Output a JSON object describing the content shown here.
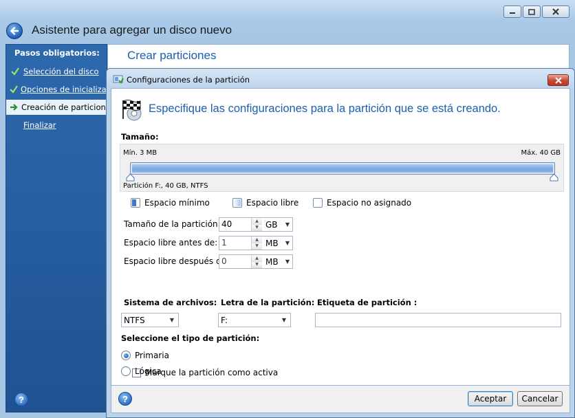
{
  "wizard": {
    "title": "Asistente para agregar un disco nuevo",
    "content_title": "Crear particiones",
    "sidebar": {
      "heading": "Pasos obligatorios:",
      "steps": [
        {
          "label": "Selección del disco",
          "state": "done"
        },
        {
          "label": "Opciones de inicialización",
          "state": "done"
        },
        {
          "label": "Creación de particiones",
          "state": "current"
        },
        {
          "label": "Finalizar",
          "state": "pending"
        }
      ]
    }
  },
  "dialog": {
    "title": "Configuraciones de la partición",
    "heading": "Especifique las configuraciones para la partición que se está creando.",
    "size": {
      "label": "Tamaño:",
      "min_label": "Mín. 3 MB",
      "max_label": "Máx. 40 GB",
      "partition_label": "Partición F:, 40 GB, NTFS",
      "fill_fraction": 1.0
    },
    "legend": {
      "min_space": "Espacio mínimo",
      "free_space": "Espacio libre",
      "unallocated": "Espacio no asignado"
    },
    "fields": {
      "partition_size": {
        "label": "Tamaño de la partición:",
        "value": "40",
        "unit": "GB"
      },
      "free_before": {
        "label": "Espacio libre antes de:",
        "value": "1",
        "unit": "MB"
      },
      "free_after": {
        "label": "Espacio libre después de:",
        "value": "0",
        "unit": "MB"
      }
    },
    "filesystem": {
      "label": "Sistema de archivos:",
      "value": "NTFS"
    },
    "letter": {
      "label": "Letra de la partición:",
      "value": "F:"
    },
    "volume_label": {
      "label": "Etiqueta de partición :",
      "value": ""
    },
    "partition_type": {
      "label": "Seleccione el tipo de partición:",
      "primary": "Primaria",
      "active_checkbox": "Marque la partición como activa",
      "logical": "Lógica",
      "selected": "primary",
      "active_checked": false
    },
    "buttons": {
      "ok": "Aceptar",
      "cancel": "Cancelar"
    }
  },
  "colors": {
    "accent_blue": "#1c5fb0",
    "sidebar_blue": "#2d69ad",
    "close_red": "#c7462e"
  }
}
